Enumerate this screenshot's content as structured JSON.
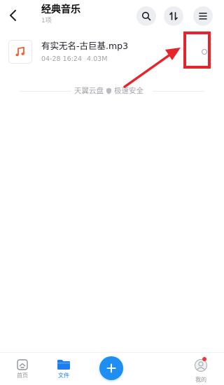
{
  "header": {
    "title": "经典音乐",
    "subtitle": "1项",
    "icons": [
      "back-icon",
      "search-icon",
      "sort-icon",
      "menu-icon"
    ]
  },
  "files": [
    {
      "name": "有实无名-古巨基.mp3",
      "date": "04-28 16:24",
      "size": "4.03M",
      "icon": "music-note-icon",
      "icon_color": "#f0612d"
    }
  ],
  "brand": {
    "left": "天翼云盘",
    "right": "极速安全"
  },
  "bottom_nav": {
    "items": [
      {
        "label": "首页",
        "icon": "home-icon",
        "active": false
      },
      {
        "label": "文件",
        "icon": "folder-icon",
        "active": true
      },
      {
        "label": "我的",
        "icon": "profile-icon",
        "active": false
      }
    ],
    "add_icon": "plus-icon"
  },
  "colors": {
    "accent": "#1e8ef3",
    "annotation": "#e6242b",
    "badge": "#f0343c"
  }
}
